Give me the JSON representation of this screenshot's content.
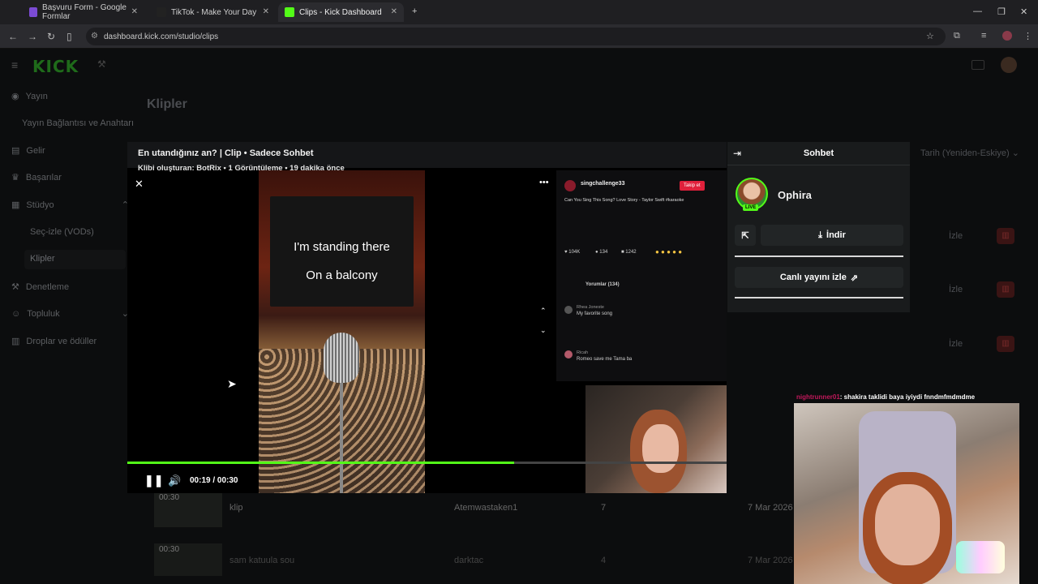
{
  "browser": {
    "tabs": [
      {
        "label": "Başvuru Form - Google Formlar",
        "fav_color": "#7b4bd4"
      },
      {
        "label": "TikTok - Make Your Day",
        "fav_color": "#222"
      },
      {
        "label": "Clips - Kick Dashboard",
        "fav_color": "#53fc18"
      }
    ],
    "url": "dashboard.kick.com/studio/clips"
  },
  "kick": {
    "logo": "KICK",
    "sidebar": [
      {
        "label": "Yayın",
        "icon": "broadcast-icon"
      },
      {
        "label": "Yayın Bağlantısı ve Anahtarı",
        "sub": true
      },
      {
        "label": "Gelir",
        "icon": "revenue-icon"
      },
      {
        "label": "Başarılar",
        "icon": "trophy-icon"
      },
      {
        "label": "Stüdyo",
        "icon": "studio-icon"
      },
      {
        "label": "Seç-izle (VODs)",
        "sub": true
      },
      {
        "label": "Klipler",
        "sub": true
      },
      {
        "label": "Denetleme",
        "icon": "moderation-icon"
      },
      {
        "label": "Topluluk",
        "icon": "community-icon"
      },
      {
        "label": "Droplar ve ödüller",
        "icon": "drops-icon"
      }
    ],
    "page_title": "Klipler",
    "sort_label": "Tarih (Yeniden-Eskiye)",
    "watch_label": "İzle",
    "row1": {
      "duration": "00:30",
      "title": "klip",
      "creator": "Atemwastaken1",
      "views": "7",
      "date": "7 Mar 2026"
    },
    "row2": {
      "duration": "00:30",
      "title": "sam katuula sou",
      "creator": "darktac",
      "views": "4",
      "date": "7 Mar 2026"
    }
  },
  "clip": {
    "title": "En utandığınız an? | Clip • Sadece Sohbet",
    "subtitle": "Klibi oluşturan: BotRix • 1 Görüntüleme • 19 dakika önce",
    "lyric_line1": "I'm standing there",
    "lyric_line2": "On a balcony",
    "time": "00:19 / 00:30",
    "progress": 0.65,
    "tiktok": {
      "user": "singchallenge33",
      "follow": "Takip et",
      "caption": "Can You Sing This Song? Love Story - Taylor Swift #karaoke",
      "likes": "104K",
      "comments": "134",
      "saves": "1242",
      "comments_tab": "Yorumlar (134)",
      "c1_user": "Rhea Joneste",
      "c1_text": "My favorite song",
      "c2_user": "Ricah",
      "c2_text": "Romeo save me Tama ba"
    }
  },
  "chat": {
    "title": "Sohbet",
    "streamer": "Ophira",
    "live": "LIVE",
    "download": "İndir",
    "watch_live": "Canlı yayını izle"
  },
  "overlay": {
    "chat_user": "nightrunner01",
    "chat_msg": ": shakira taklidi baya iyiydi fnndmfmdmdme"
  }
}
